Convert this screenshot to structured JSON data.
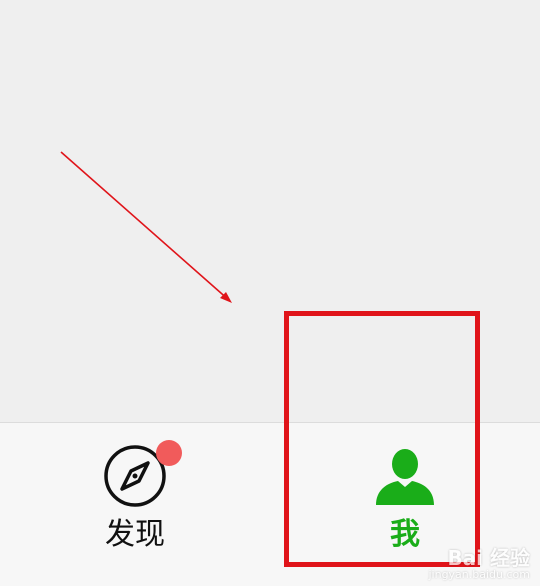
{
  "tab_bar": {
    "tabs": [
      {
        "label": "发现",
        "icon": "compass-icon",
        "has_badge": true,
        "active": false
      },
      {
        "label": "我",
        "icon": "person-icon",
        "has_badge": false,
        "active": true
      }
    ]
  },
  "colors": {
    "background": "#efefef",
    "tab_bar_background": "#f7f7f7",
    "active_green": "#1aad19",
    "badge_red": "#f15b5b",
    "annotation_red": "#e0141a"
  },
  "watermark": {
    "brand": "Bai 经验",
    "url": "jingyan.baidu.com"
  }
}
